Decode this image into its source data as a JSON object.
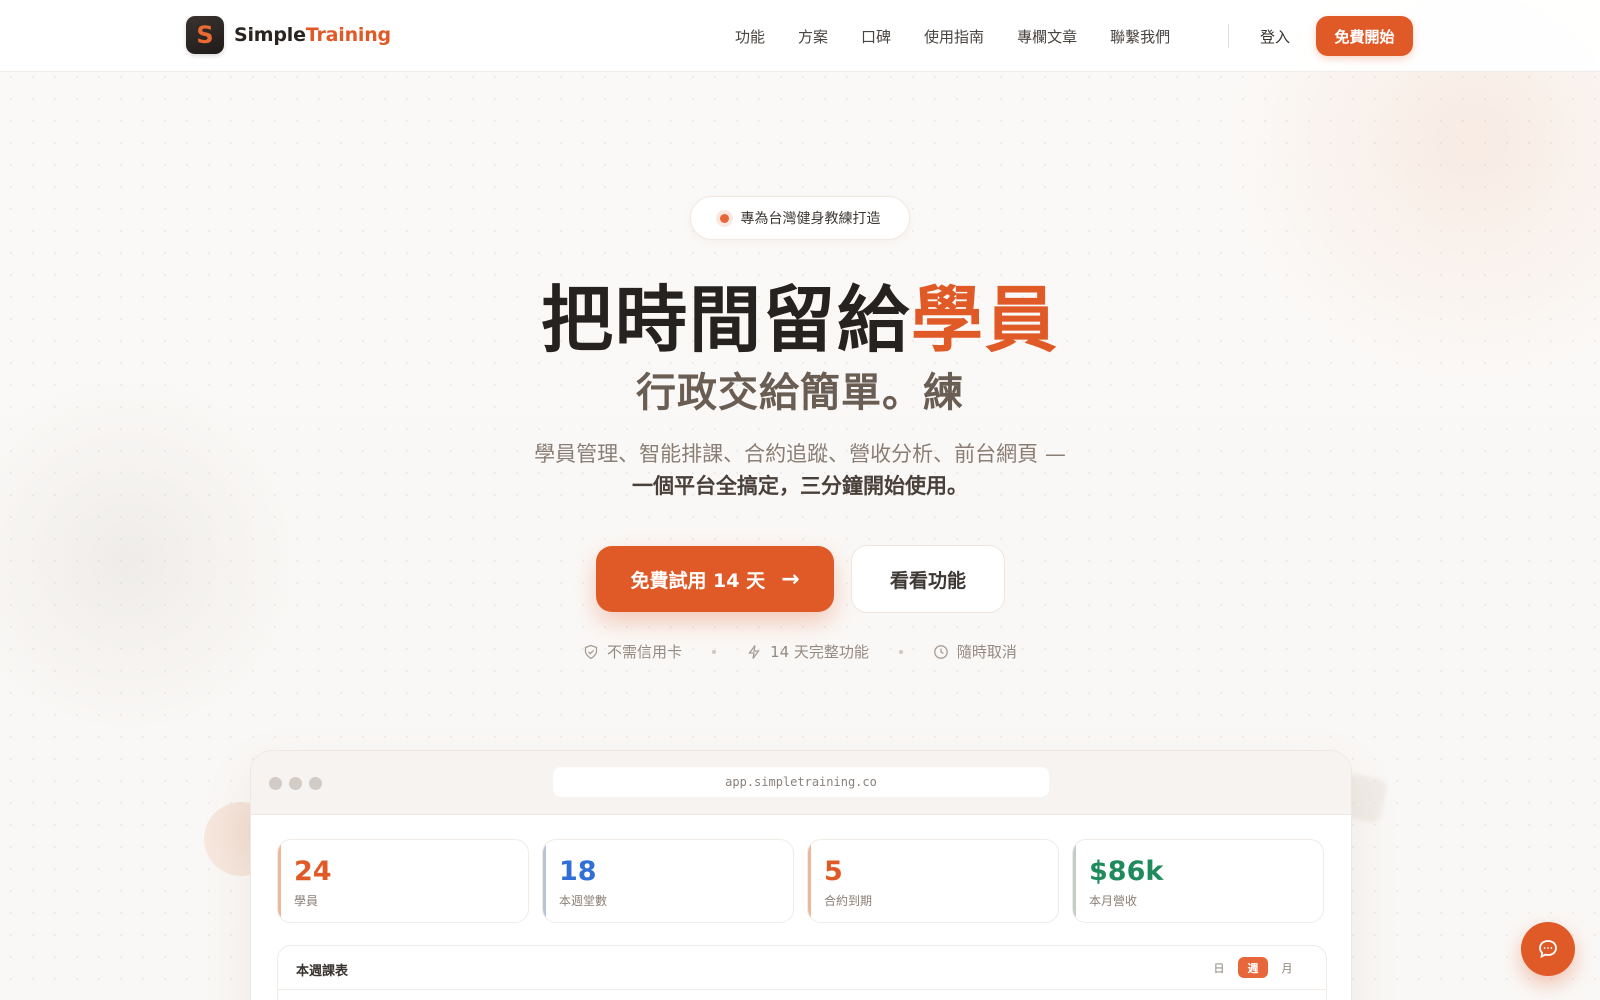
{
  "nav": {
    "logo_letter": "S",
    "brand_part1": "Simple",
    "brand_part2": "Training",
    "links": [
      "功能",
      "方案",
      "口碑",
      "使用指南",
      "專欄文章",
      "聯繫我們"
    ],
    "login": "登入",
    "cta": "免費開始"
  },
  "hero": {
    "badge": "專為台灣健身教練打造",
    "title_main": "把時間留給",
    "title_accent": "學員",
    "subtitle": "行政交給簡單。練",
    "desc_line1": "學員管理、智能排課、合約追蹤、營收分析、前台網頁 —",
    "desc_line2": "一個平台全搞定，三分鐘開始使用。",
    "primary_button": "免費試用 14 天",
    "secondary_button": "看看功能",
    "perks": [
      "不需信用卡",
      "14 天完整功能",
      "隨時取消"
    ]
  },
  "preview": {
    "url": "app.simpletraining.co",
    "stats": [
      {
        "value": "24",
        "label": "學員",
        "color": "#e05a28"
      },
      {
        "value": "18",
        "label": "本週堂數",
        "color": "#2f6fd6"
      },
      {
        "value": "5",
        "label": "合約到期",
        "color": "#e05a28"
      },
      {
        "value": "$86k",
        "label": "本月營收",
        "color": "#1f8a5c"
      }
    ],
    "schedule_title": "本週課表",
    "schedule_tabs": [
      "日",
      "週",
      "月"
    ],
    "schedule_active": "週"
  },
  "icons": {
    "perk_icons": [
      "shield-check-icon",
      "lightning-icon",
      "clock-icon"
    ],
    "chat": "chat-bubble-icon",
    "arrow": "arrow-right-icon"
  },
  "colors": {
    "accent": "#e05a28",
    "text_dark": "#262220",
    "background": "#faf8f6"
  }
}
